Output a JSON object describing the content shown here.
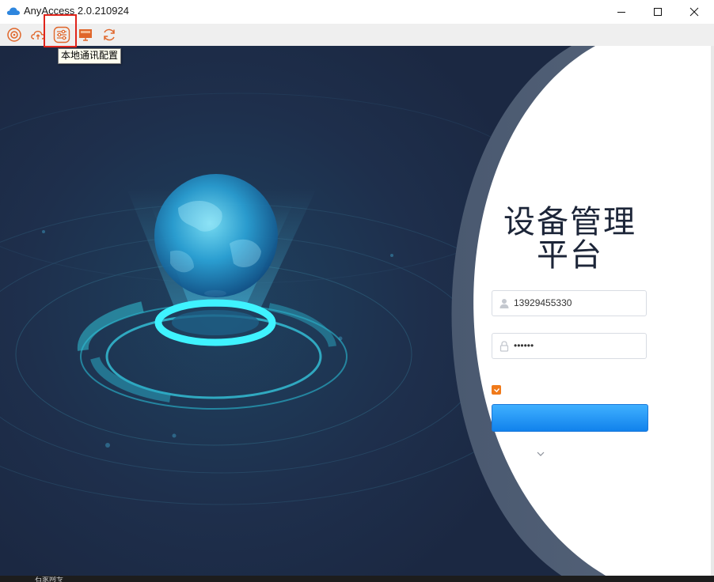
{
  "window": {
    "title": "AnyAccess 2.0.210924",
    "controls": {
      "minimize": "minimize-icon",
      "maximize": "maximize-icon",
      "close": "close-icon"
    }
  },
  "toolbar": {
    "buttons": [
      {
        "name": "target-icon"
      },
      {
        "name": "cloud-sync-icon"
      },
      {
        "name": "sliders-icon"
      },
      {
        "name": "screen-icon"
      },
      {
        "name": "refresh-icon"
      }
    ],
    "tooltip": "本地通讯配置"
  },
  "login": {
    "title_line1": "设备管理",
    "title_line2": "平台",
    "username_value": "13929455330",
    "password_value": "••••••",
    "username_icon": "user-icon",
    "password_icon": "lock-icon",
    "remember_checked": true,
    "login_button_label": "",
    "expand_icon": "chevron-down-icon"
  },
  "colors": {
    "accent_orange": "#f07a1a",
    "toolbar_icon": "#e0662a",
    "background_navy": "#1e2c47",
    "login_button": "#1a8cf2",
    "highlight_red": "#e0241b"
  },
  "taskbar": {
    "label": "石家网专"
  }
}
